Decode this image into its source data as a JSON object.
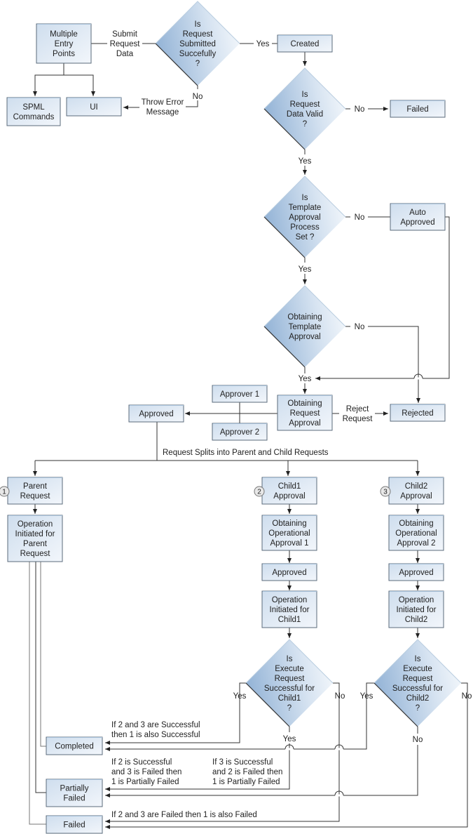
{
  "boxes": {
    "multiple_entry_points": [
      "Multiple",
      "Entry",
      "Points"
    ],
    "spml_commands": [
      "SPML",
      "Commands"
    ],
    "ui": [
      "UI"
    ],
    "created": [
      "Created"
    ],
    "failed_top": [
      "Failed"
    ],
    "auto_approved": [
      "Auto",
      "Approved"
    ],
    "approver1": [
      "Approver 1"
    ],
    "approver2": [
      "Approver 2"
    ],
    "obtaining_request_approval": [
      "Obtaining",
      "Request",
      "Approval"
    ],
    "approved_main": [
      "Approved"
    ],
    "rejected": [
      "Rejected"
    ],
    "parent_request": [
      "Parent",
      "Request"
    ],
    "op_parent": [
      "Operation",
      "Initiated for",
      "Parent",
      "Request"
    ],
    "child1_approval": [
      "Child1",
      "Approval"
    ],
    "obtaining_op1": [
      "Obtaining",
      "Operational",
      "Approval 1"
    ],
    "approved_child1": [
      "Approved"
    ],
    "op_child1": [
      "Operation",
      "Initiated for",
      "Child1"
    ],
    "child2_approval": [
      "Child2",
      "Approval"
    ],
    "obtaining_op2": [
      "Obtaining",
      "Operational",
      "Approval 2"
    ],
    "approved_child2": [
      "Approved"
    ],
    "op_child2": [
      "Operation",
      "Initiated for",
      "Child2"
    ],
    "completed": [
      "Completed"
    ],
    "partially_failed": [
      "Partially",
      "Failed"
    ],
    "failed_bottom": [
      "Failed"
    ]
  },
  "decisions": {
    "submitted": [
      "Is",
      "Request",
      "Submitted",
      "Succefully",
      "?"
    ],
    "data_valid": [
      "Is",
      "Request",
      "Data Valid",
      "?"
    ],
    "template_set": [
      "Is",
      "Template",
      "Approval",
      "Process",
      "Set ?"
    ],
    "template_approval": [
      "Obtaining",
      "Template",
      "Approval"
    ],
    "exec_child1": [
      "Is",
      "Execute",
      "Request",
      "Successful for",
      "Child1",
      "?"
    ],
    "exec_child2": [
      "Is",
      "Execute",
      "Request",
      "Successful for",
      "Child2",
      "?"
    ]
  },
  "labels": {
    "submit_request_data": [
      "Submit",
      "Request",
      "Data"
    ],
    "throw_error": [
      "Throw Error",
      "Message"
    ],
    "yes": "Yes",
    "no": "No",
    "reject_request": [
      "Reject",
      "Request"
    ],
    "split": "Request Splits into Parent and Child Requests",
    "cond_completed": [
      "If 2 and 3 are Successful",
      "then 1 is also Successful"
    ],
    "cond_partial_a": [
      "If 2 is Successful",
      "and 3 is Failed then",
      "1 is Partially Failed"
    ],
    "cond_partial_b": [
      "If 3 is Successful",
      "and 2 is Failed then",
      "1 is Partially Failed"
    ],
    "cond_failed": "If 2 and 3 are Failed then 1 is also Failed"
  },
  "badges": [
    "1",
    "2",
    "3"
  ]
}
